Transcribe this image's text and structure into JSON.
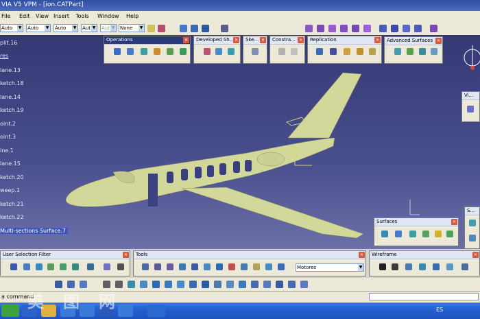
{
  "window": {
    "title": "VIA V5 VPM - [ion.CATPart]"
  },
  "menu": [
    "File",
    "Edit",
    "View",
    "Insert",
    "Tools",
    "Window",
    "Help"
  ],
  "std_toolbar": {
    "combos": [
      "Auto",
      "Auto",
      "Auto",
      "Aut",
      "Aut",
      "None"
    ]
  },
  "tree": {
    "items": [
      "plit.16",
      "res",
      "lane.13",
      "ketch.18",
      "lane.14",
      "ketch.19",
      "oint.2",
      "oint.3",
      "ine.1",
      "lane.15",
      "ketch.20",
      "weep.1",
      "ketch.21",
      "ketch.22",
      "Multi-sections Surface.7"
    ],
    "selected_index": 14
  },
  "palettes": {
    "operations": "Operations",
    "developed": "Developed Sh...",
    "sketch": "Ske...",
    "constraints": "Constra...",
    "replication": "Replication",
    "advanced_surfaces": "Advanced Surfaces",
    "vi": "Vi...",
    "surfaces": "Surfaces",
    "s": "S..."
  },
  "bottom_toolbars": {
    "user_selection_filter": "User Selection Filter",
    "tools": "Tools",
    "tools_combo": "Motores",
    "wireframe": "Wireframe"
  },
  "status": {
    "prompt": "a command",
    "lang": "ES"
  },
  "colors": {
    "viewport_top": "#343873",
    "aircraft": "#d2d79a",
    "selection": "#3d56b8"
  },
  "watermark": [
    "美",
    "图",
    "网"
  ]
}
